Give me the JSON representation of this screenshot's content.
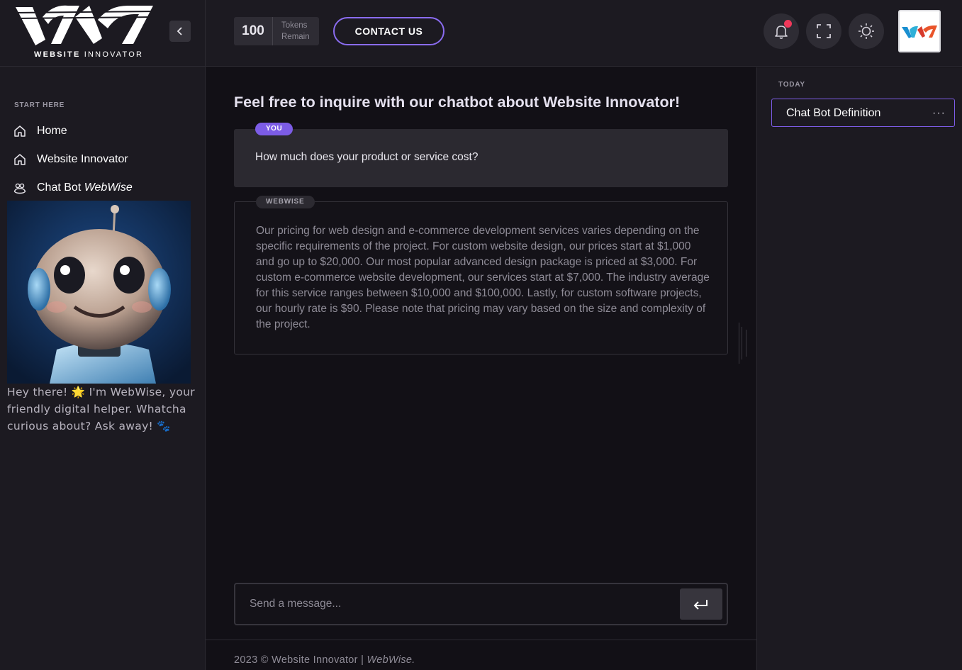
{
  "brand": {
    "name_bold": "WEBSITE",
    "name_rest": "INNOVATOR"
  },
  "sidebar": {
    "section_title": "START HERE",
    "items": [
      {
        "label": "Home",
        "icon": "home-icon"
      },
      {
        "label": "Website Innovator",
        "icon": "home-icon"
      },
      {
        "label": "Chat Bot ",
        "label_em": "WebWise",
        "icon": "users-icon"
      }
    ],
    "robot_caption": "Hey there! 🌟 I'm WebWise, your friendly digital helper. Whatcha curious about? Ask away! 🐾"
  },
  "header": {
    "tokens_value": "100",
    "tokens_label_1": "Tokens",
    "tokens_label_2": "Remain",
    "contact_label": "CONTACT US",
    "icons": [
      "bell-icon",
      "fullscreen-icon",
      "sun-icon"
    ]
  },
  "main": {
    "title": "Feel free to inquire with our chatbot about Website Innovator!",
    "user_badge": "YOU",
    "user_message": "How much does your product or service cost?",
    "bot_badge": "WEBWISE",
    "bot_message": "Our pricing for web design and e-commerce development services varies depending on the specific requirements of the project. For custom website design, our prices start at $1,000 and go up to $20,000. Our most popular advanced design package is priced at $3,000. For custom e-commerce website development, our services start at $7,000. The industry average for this service ranges between $10,000 and $100,000. Lastly, for custom software projects, our hourly rate is $90. Please note that pricing may vary based on the size and complexity of the project.",
    "input_placeholder": "Send a message...",
    "footer_text": "2023 © Website Innovator | ",
    "footer_em": "WebWise."
  },
  "history": {
    "group_label": "TODAY",
    "items": [
      {
        "label": "Chat Bot Definition",
        "more": "···"
      }
    ]
  },
  "colors": {
    "accent": "#7c5ce6",
    "notification": "#f0385a",
    "background": "#121016",
    "panel": "#1c1a21"
  }
}
